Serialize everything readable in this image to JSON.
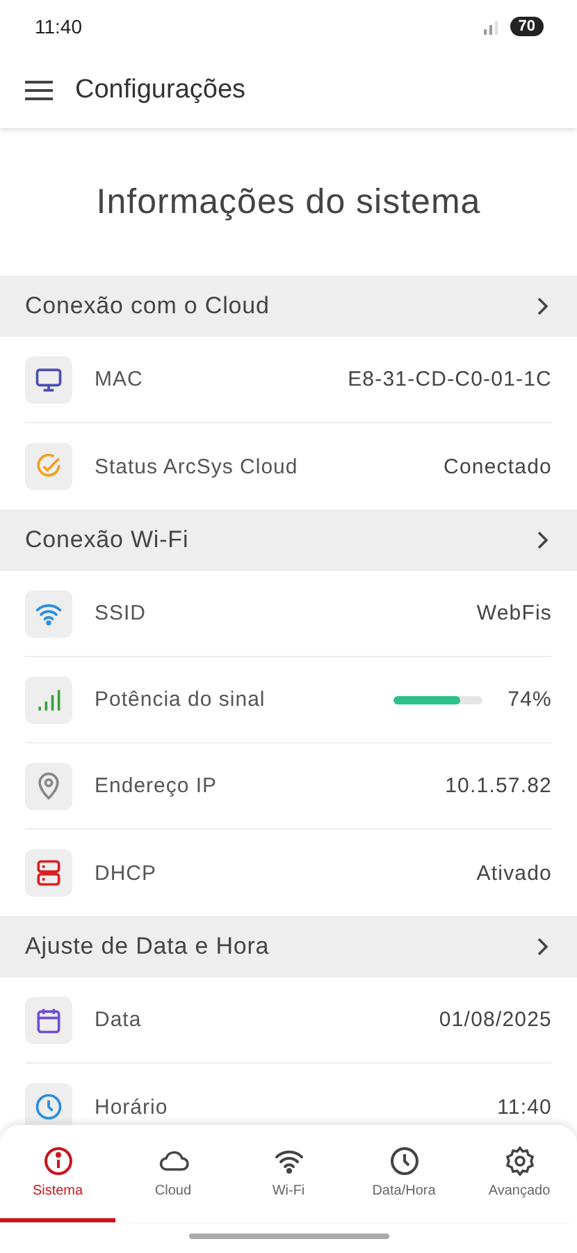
{
  "status_bar": {
    "time": "11:40",
    "battery": "70"
  },
  "app_bar": {
    "title": "Configurações"
  },
  "page_title": "Informações do sistema",
  "sections": [
    {
      "title": "Conexão com o Cloud",
      "rows": [
        {
          "kind": "text",
          "label": "MAC",
          "value": "E8-31-CD-C0-01-1C"
        },
        {
          "kind": "text",
          "label": "Status ArcSys Cloud",
          "value": "Conectado"
        }
      ]
    },
    {
      "title": "Conexão Wi-Fi",
      "rows": [
        {
          "kind": "text",
          "label": "SSID",
          "value": "WebFis"
        },
        {
          "kind": "meter",
          "label": "Potência do sinal",
          "level": 0.74,
          "value": "74%"
        },
        {
          "kind": "text",
          "label": "Endereço IP",
          "value": "10.1.57.82"
        },
        {
          "kind": "text",
          "label": "DHCP",
          "value": "Ativado"
        }
      ]
    },
    {
      "title": "Ajuste de Data e Hora",
      "rows": [
        {
          "kind": "text",
          "label": "Data",
          "value": "01/08/2025"
        },
        {
          "kind": "text",
          "label": "Horário",
          "value": "11:40"
        }
      ]
    }
  ],
  "bottom_nav": [
    {
      "label": "Sistema",
      "selected": true
    },
    {
      "label": "Cloud",
      "selected": false
    },
    {
      "label": "Wi-Fi",
      "selected": false
    },
    {
      "label": "Data/Hora",
      "selected": false
    },
    {
      "label": "Avançado",
      "selected": false
    }
  ]
}
